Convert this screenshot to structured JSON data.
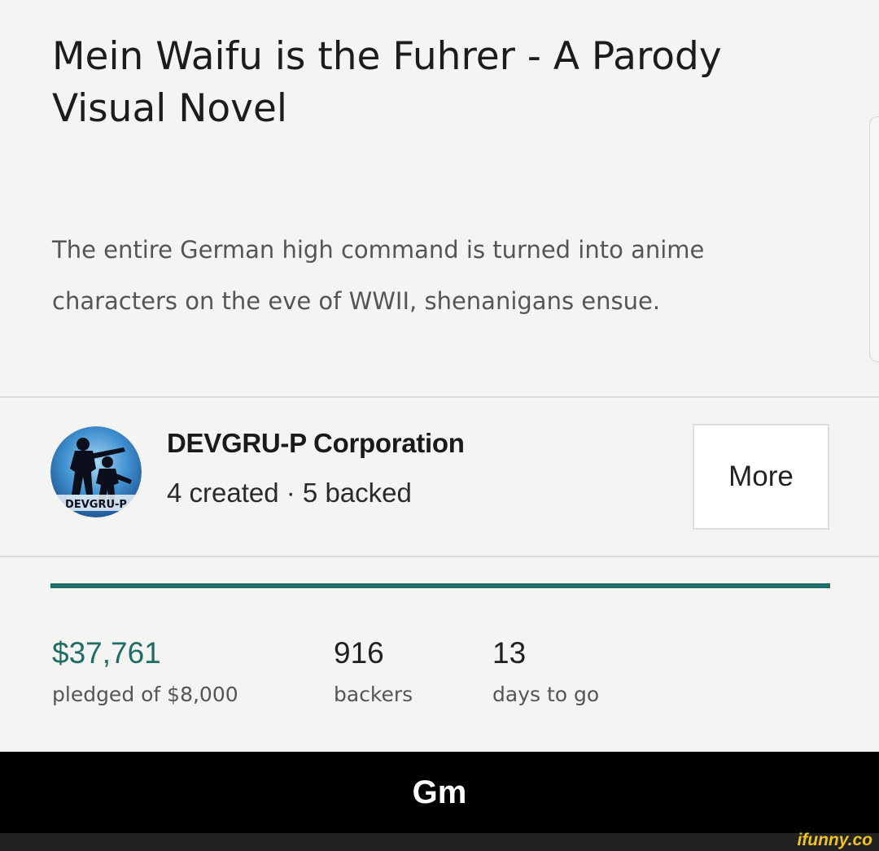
{
  "project": {
    "title": "Mein Waifu is the Fuhrer - A Parody Visual Novel",
    "blurb": "The entire German high command is turned into anime characters on the eve of WWII, shenanigans ensue."
  },
  "creator": {
    "name": "DEVGRU-P Corporation",
    "stats": "4 created · 5 backed",
    "avatar_text": "DEVGRU-P",
    "more_label": "More"
  },
  "funding": {
    "progress_fraction": 1.0,
    "accent_color": "#1e6c63",
    "pledged": "$37,761",
    "pledged_label": "pledged of $8,000",
    "backers": "916",
    "backers_label": "backers",
    "days": "13",
    "days_label": "days to go"
  },
  "meme": {
    "caption": "Gm",
    "watermark": "ifunny.co"
  }
}
